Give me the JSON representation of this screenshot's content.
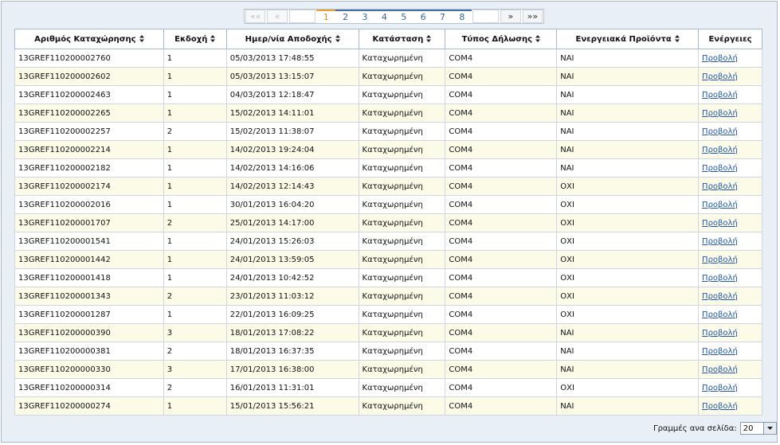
{
  "pager": {
    "first": "««",
    "prev": "«",
    "pages": [
      "1",
      "2",
      "3",
      "4",
      "5",
      "6",
      "7",
      "8"
    ],
    "current_page": "1",
    "next": "»",
    "last": "»»"
  },
  "table": {
    "columns": [
      "Αριθμός Καταχώρησης",
      "Εκδοχή",
      "Ημερ/νία Αποδοχής",
      "Κατάσταση",
      "Τύπος Δήλωσης",
      "Ενεργειακά Προϊόντα",
      "Ενέργειες"
    ],
    "rows": [
      [
        "13GREF110200002760",
        "1",
        "05/03/2013 17:48:55",
        "Καταχωρημένη",
        "COM4",
        "ΝΑΙ",
        "Προβολή"
      ],
      [
        "13GREF110200002602",
        "1",
        "05/03/2013 13:15:07",
        "Καταχωρημένη",
        "COM4",
        "ΝΑΙ",
        "Προβολή"
      ],
      [
        "13GREF110200002463",
        "1",
        "04/03/2013 12:18:47",
        "Καταχωρημένη",
        "COM4",
        "ΝΑΙ",
        "Προβολή"
      ],
      [
        "13GREF110200002265",
        "1",
        "15/02/2013 14:11:01",
        "Καταχωρημένη",
        "COM4",
        "ΝΑΙ",
        "Προβολή"
      ],
      [
        "13GREF110200002257",
        "2",
        "15/02/2013 11:38:07",
        "Καταχωρημένη",
        "COM4",
        "ΝΑΙ",
        "Προβολή"
      ],
      [
        "13GREF110200002214",
        "1",
        "14/02/2013 19:24:04",
        "Καταχωρημένη",
        "COM4",
        "ΝΑΙ",
        "Προβολή"
      ],
      [
        "13GREF110200002182",
        "1",
        "14/02/2013 14:16:06",
        "Καταχωρημένη",
        "COM4",
        "ΝΑΙ",
        "Προβολή"
      ],
      [
        "13GREF110200002174",
        "1",
        "14/02/2013 12:14:43",
        "Καταχωρημένη",
        "COM4",
        "ΟΧΙ",
        "Προβολή"
      ],
      [
        "13GREF110200002016",
        "1",
        "30/01/2013 16:04:20",
        "Καταχωρημένη",
        "COM4",
        "ΟΧΙ",
        "Προβολή"
      ],
      [
        "13GREF110200001707",
        "2",
        "25/01/2013 14:17:00",
        "Καταχωρημένη",
        "COM4",
        "ΟΧΙ",
        "Προβολή"
      ],
      [
        "13GREF110200001541",
        "1",
        "24/01/2013 15:26:03",
        "Καταχωρημένη",
        "COM4",
        "ΟΧΙ",
        "Προβολή"
      ],
      [
        "13GREF110200001442",
        "1",
        "24/01/2013 13:59:05",
        "Καταχωρημένη",
        "COM4",
        "ΟΧΙ",
        "Προβολή"
      ],
      [
        "13GREF110200001418",
        "1",
        "24/01/2013 10:42:52",
        "Καταχωρημένη",
        "COM4",
        "ΟΧΙ",
        "Προβολή"
      ],
      [
        "13GREF110200001343",
        "2",
        "23/01/2013 11:03:12",
        "Καταχωρημένη",
        "COM4",
        "ΟΧΙ",
        "Προβολή"
      ],
      [
        "13GREF110200001287",
        "1",
        "22/01/2013 16:09:25",
        "Καταχωρημένη",
        "COM4",
        "ΟΧΙ",
        "Προβολή"
      ],
      [
        "13GREF110200000390",
        "3",
        "18/01/2013 17:08:22",
        "Καταχωρημένη",
        "COM4",
        "ΝΑΙ",
        "Προβολή"
      ],
      [
        "13GREF110200000381",
        "2",
        "18/01/2013 16:37:35",
        "Καταχωρημένη",
        "COM4",
        "ΝΑΙ",
        "Προβολή"
      ],
      [
        "13GREF110200000330",
        "3",
        "17/01/2013 16:38:00",
        "Καταχωρημένη",
        "COM4",
        "ΝΑΙ",
        "Προβολή"
      ],
      [
        "13GREF110200000314",
        "2",
        "16/01/2013 11:31:01",
        "Καταχωρημένη",
        "COM4",
        "ΟΧΙ",
        "Προβολή"
      ],
      [
        "13GREF110200000274",
        "1",
        "15/01/2013 15:56:21",
        "Καταχωρημένη",
        "COM4",
        "ΝΑΙ",
        "Προβολή"
      ]
    ]
  },
  "footer": {
    "rows_per_page_label": "Γραμμές ανα σελίδα:",
    "rows_per_page_value": "20"
  },
  "icons": {
    "sort": "sort-icon",
    "dropdown": "chevron-down-icon"
  },
  "colors": {
    "link": "#2058b0",
    "current_page": "#e08a10",
    "alt_row": "#fbfbe8",
    "frame_bg": "#e9eff6"
  }
}
